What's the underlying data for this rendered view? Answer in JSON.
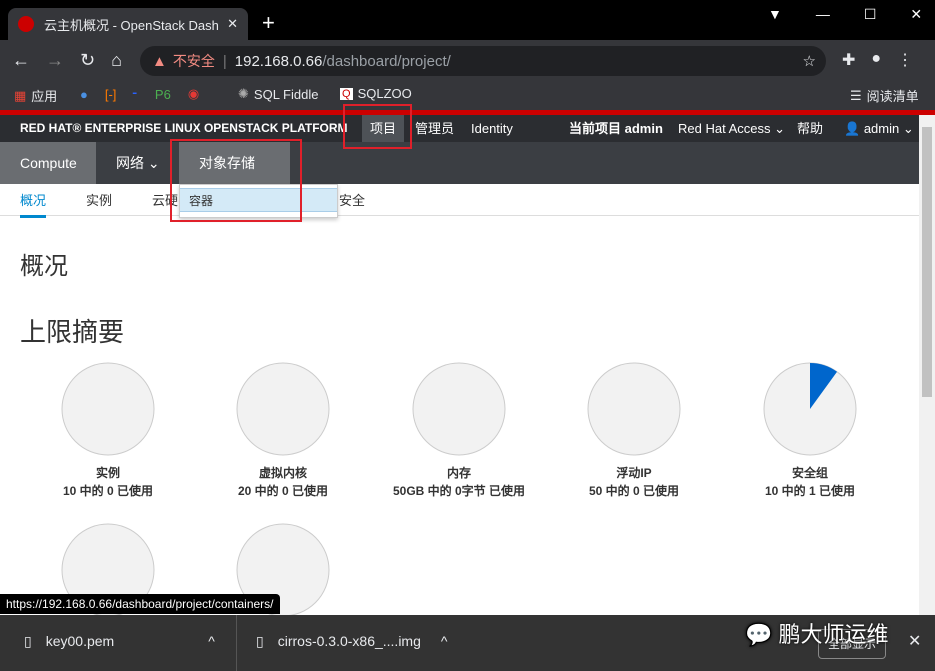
{
  "browser": {
    "tab_title": "云主机概况 - OpenStack Dashb",
    "new_tab": "+",
    "insecure_label": "不安全",
    "url_host": "192.168.0.66",
    "url_path": "/dashboard/project/",
    "reading_list": "阅读清单",
    "bookmarks": [
      {
        "label": "应用"
      },
      {
        "label": "SQL Fiddle"
      },
      {
        "label": "SQLZOO"
      }
    ]
  },
  "topnav": {
    "brand": "RED HAT® ENTERPRISE LINUX OPENSTACK PLATFORM",
    "items": [
      "项目",
      "管理员",
      "Identity"
    ],
    "current_project": "当前项目 admin",
    "redhat_access": "Red Hat Access",
    "help": "帮助",
    "user": "admin"
  },
  "secnav": {
    "items": [
      "Compute",
      "网络",
      "对象存储"
    ]
  },
  "dropdown": {
    "items": [
      "容器"
    ]
  },
  "subnav": {
    "items": [
      "概况",
      "实例",
      "云硬",
      "安全"
    ]
  },
  "page": {
    "title": "概况",
    "section": "上限摘要"
  },
  "accent": "#0066cc",
  "quotas": [
    {
      "name": "实例",
      "text": "10 中的 0 已使用",
      "used": 0,
      "total": 10
    },
    {
      "name": "虚拟内核",
      "text": "20 中的 0 已使用",
      "used": 0,
      "total": 20
    },
    {
      "name": "内存",
      "text": "50GB 中的 0字节 已使用",
      "used": 0,
      "total": 50
    },
    {
      "name": "浮动IP",
      "text": "50 中的 0 已使用",
      "used": 0,
      "total": 50
    },
    {
      "name": "安全组",
      "text": "10 中的 1 已使用",
      "used": 1,
      "total": 10
    }
  ],
  "status_url": "https://192.168.0.66/dashboard/project/containers/",
  "downloads": {
    "files": [
      "key00.pem",
      "cirros-0.3.0-x86_....img"
    ],
    "show_all": "全部显示",
    "watermark": "鹏大师运维"
  }
}
